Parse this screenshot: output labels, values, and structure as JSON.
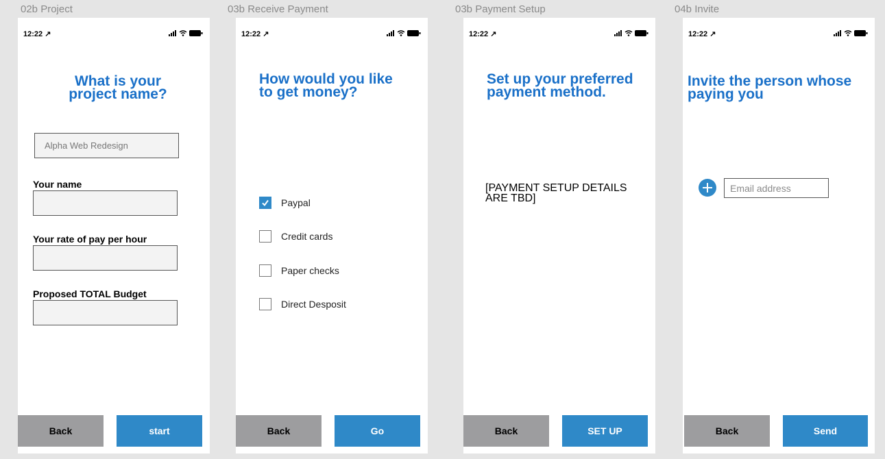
{
  "frames": [
    {
      "label": "02b Project",
      "status": {
        "time": "12:22 ↗"
      },
      "title_line1": "What is your",
      "title_line2": "project name?",
      "project_name_input": {
        "value": "Alpha Web Redesign"
      },
      "fields": [
        {
          "label": "Your name",
          "value": ""
        },
        {
          "label": "Your rate of pay per hour",
          "value": ""
        },
        {
          "label": "Proposed TOTAL Budget",
          "value": ""
        }
      ],
      "back_label": "Back",
      "primary_label": "start"
    },
    {
      "label": "03b Receive Payment",
      "status": {
        "time": "12:22 ↗"
      },
      "title_line1": "How would you like",
      "title_line2": "to get money?",
      "options": [
        {
          "label": "Paypal",
          "checked": true
        },
        {
          "label": "Credit cards",
          "checked": false
        },
        {
          "label": "Paper checks",
          "checked": false
        },
        {
          "label": "Direct Desposit",
          "checked": false
        }
      ],
      "back_label": "Back",
      "primary_label": "Go"
    },
    {
      "label": "03b Payment Setup",
      "status": {
        "time": "12:22 ↗"
      },
      "title_line1": "Set up your preferred",
      "title_line2": "payment method.",
      "tbd_line1": "[PAYMENT SETUP DETAILS",
      "tbd_line2": "ARE TBD]",
      "back_label": "Back",
      "primary_label": "SET UP"
    },
    {
      "label": "04b Invite",
      "status": {
        "time": "12:22 ↗"
      },
      "title_line1": "Invite the person whose",
      "title_line2": "paying you",
      "email_input": {
        "placeholder": "Email address",
        "value": ""
      },
      "back_label": "Back",
      "primary_label": "Send"
    }
  ],
  "colors": {
    "accent": "#2f89c8",
    "title": "#1a70c8",
    "back_button": "#9d9d9f",
    "canvas": "#e5e5e5"
  },
  "icons": {
    "status": [
      "cellular-signal-icon",
      "wifi-icon",
      "battery-icon"
    ],
    "invite_add": "plus-circle-icon",
    "checkmark": "checkmark-icon"
  }
}
